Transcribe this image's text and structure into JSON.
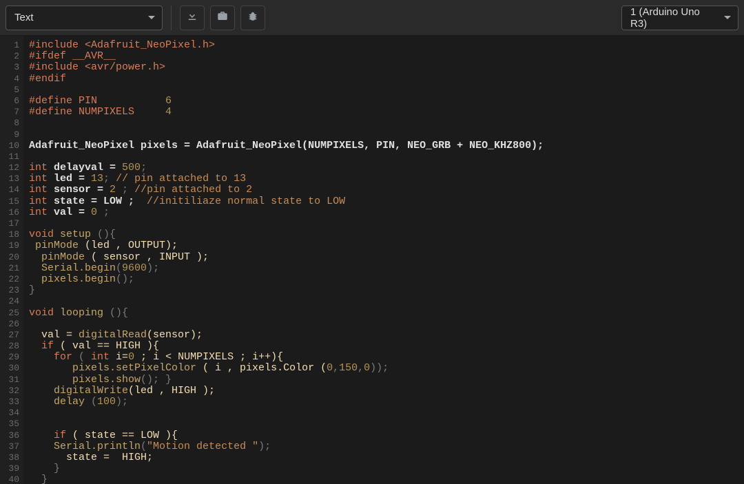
{
  "toolbar": {
    "mode_dropdown": "Text",
    "board_dropdown": "1 (Arduino Uno R3)"
  },
  "icons": {
    "download": "download-icon",
    "library": "briefcase-icon",
    "debug": "bug-icon"
  },
  "code_lines": [
    {
      "n": 1,
      "t": "#include <Adafruit_NeoPixel.h>",
      "cls": "cpp"
    },
    {
      "n": 2,
      "t": "#ifdef __AVR__",
      "cls": "cpp"
    },
    {
      "n": 3,
      "t": "#include <avr/power.h>",
      "cls": "cpp"
    },
    {
      "n": 4,
      "t": "#endif",
      "cls": "cpp"
    },
    {
      "n": 5,
      "t": "",
      "cls": "cg"
    },
    {
      "n": 6,
      "segments": [
        {
          "t": "#define PIN           ",
          "c": "cpp"
        },
        {
          "t": "6",
          "c": "cnu"
        }
      ]
    },
    {
      "n": 7,
      "segments": [
        {
          "t": "#define NUMPIXELS     ",
          "c": "cpp"
        },
        {
          "t": "4",
          "c": "cnu"
        }
      ]
    },
    {
      "n": 8,
      "t": "",
      "cls": "cg"
    },
    {
      "n": 9,
      "t": "",
      "cls": "cg"
    },
    {
      "n": 10,
      "segments": [
        {
          "t": "Adafruit_NeoPixel pixels = Adafruit_NeoPixel(NUMPIXELS, PIN, NEO_GRB + NEO_KHZ800);",
          "c": "cw"
        }
      ]
    },
    {
      "n": 11,
      "t": "",
      "cls": "cg"
    },
    {
      "n": 12,
      "segments": [
        {
          "t": "int ",
          "c": "cty"
        },
        {
          "t": "delayval = ",
          "c": "cw"
        },
        {
          "t": "500",
          "c": "cnu"
        },
        {
          "t": ";",
          "c": "cg"
        }
      ]
    },
    {
      "n": 13,
      "segments": [
        {
          "t": "int ",
          "c": "cty"
        },
        {
          "t": "led = ",
          "c": "cw"
        },
        {
          "t": "13",
          "c": "cnu"
        },
        {
          "t": "; ",
          "c": "cg"
        },
        {
          "t": "// pin attached to 13",
          "c": "ccm"
        }
      ]
    },
    {
      "n": 14,
      "segments": [
        {
          "t": "int ",
          "c": "cty"
        },
        {
          "t": "sensor = ",
          "c": "cw"
        },
        {
          "t": "2 ",
          "c": "cnu"
        },
        {
          "t": "; ",
          "c": "cg"
        },
        {
          "t": "//pin attached to 2",
          "c": "ccm"
        }
      ]
    },
    {
      "n": 15,
      "segments": [
        {
          "t": "int ",
          "c": "cty"
        },
        {
          "t": "state = LOW ;  ",
          "c": "cw"
        },
        {
          "t": "//initiliaze normal state to LOW",
          "c": "ccm"
        }
      ]
    },
    {
      "n": 16,
      "segments": [
        {
          "t": "int ",
          "c": "cty"
        },
        {
          "t": "val = ",
          "c": "cw"
        },
        {
          "t": "0 ",
          "c": "cnu"
        },
        {
          "t": ";",
          "c": "cg"
        }
      ]
    },
    {
      "n": 17,
      "t": "",
      "cls": "cg"
    },
    {
      "n": 18,
      "segments": [
        {
          "t": "void ",
          "c": "cty"
        },
        {
          "t": "setup ",
          "c": "cfn"
        },
        {
          "t": "(){",
          "c": "cg"
        }
      ]
    },
    {
      "n": 19,
      "segments": [
        {
          "t": " pinMode ",
          "c": "cfn"
        },
        {
          "t": "(led , OUTPUT);",
          "c": "cid"
        }
      ]
    },
    {
      "n": 20,
      "segments": [
        {
          "t": "  pinMode ",
          "c": "cfn"
        },
        {
          "t": "( sensor , INPUT );",
          "c": "cid"
        }
      ]
    },
    {
      "n": 21,
      "segments": [
        {
          "t": "  Serial.begin",
          "c": "cfn"
        },
        {
          "t": "(",
          "c": "cg"
        },
        {
          "t": "9600",
          "c": "cnu"
        },
        {
          "t": ");",
          "c": "cg"
        }
      ]
    },
    {
      "n": 22,
      "segments": [
        {
          "t": "  pixels.begin",
          "c": "cfn"
        },
        {
          "t": "();",
          "c": "cg"
        }
      ]
    },
    {
      "n": 23,
      "t": "}",
      "cls": "cg"
    },
    {
      "n": 24,
      "t": "",
      "cls": "cg"
    },
    {
      "n": 25,
      "segments": [
        {
          "t": "void ",
          "c": "cty"
        },
        {
          "t": "looping ",
          "c": "cfn"
        },
        {
          "t": "(){",
          "c": "cg"
        }
      ]
    },
    {
      "n": 26,
      "t": "",
      "cls": "cg"
    },
    {
      "n": 27,
      "segments": [
        {
          "t": "  val = ",
          "c": "cid"
        },
        {
          "t": "digitalRead",
          "c": "cfn"
        },
        {
          "t": "(sensor);",
          "c": "cid"
        }
      ]
    },
    {
      "n": 28,
      "segments": [
        {
          "t": "  if ",
          "c": "cty"
        },
        {
          "t": "( val == HIGH ){",
          "c": "cid"
        }
      ]
    },
    {
      "n": 29,
      "segments": [
        {
          "t": "    for ",
          "c": "cty"
        },
        {
          "t": "( ",
          "c": "cg"
        },
        {
          "t": "int ",
          "c": "cty"
        },
        {
          "t": "i=",
          "c": "cid"
        },
        {
          "t": "0 ",
          "c": "cnu"
        },
        {
          "t": "; i < NUMPIXELS ; i++){",
          "c": "cid"
        }
      ]
    },
    {
      "n": 30,
      "segments": [
        {
          "t": "       pixels.setPixelColor ",
          "c": "cfn"
        },
        {
          "t": "( i , pixels.Color (",
          "c": "cid"
        },
        {
          "t": "0",
          "c": "cnu"
        },
        {
          "t": ",",
          "c": "cg"
        },
        {
          "t": "150",
          "c": "cnu"
        },
        {
          "t": ",",
          "c": "cg"
        },
        {
          "t": "0",
          "c": "cnu"
        },
        {
          "t": "));",
          "c": "cg"
        }
      ]
    },
    {
      "n": 31,
      "segments": [
        {
          "t": "       pixels.show",
          "c": "cfn"
        },
        {
          "t": "(); }",
          "c": "cg"
        }
      ]
    },
    {
      "n": 32,
      "segments": [
        {
          "t": "    digitalWrite",
          "c": "cfn"
        },
        {
          "t": "(led , HIGH );",
          "c": "cid"
        }
      ]
    },
    {
      "n": 33,
      "segments": [
        {
          "t": "    delay ",
          "c": "cfn"
        },
        {
          "t": "(",
          "c": "cg"
        },
        {
          "t": "100",
          "c": "cnu"
        },
        {
          "t": ");",
          "c": "cg"
        }
      ]
    },
    {
      "n": 34,
      "t": "",
      "cls": "cg"
    },
    {
      "n": 35,
      "t": "",
      "cls": "cg"
    },
    {
      "n": 36,
      "segments": [
        {
          "t": "    if ",
          "c": "cty"
        },
        {
          "t": "( state == LOW ){",
          "c": "cid"
        }
      ]
    },
    {
      "n": 37,
      "segments": [
        {
          "t": "    Serial.println",
          "c": "cfn"
        },
        {
          "t": "(",
          "c": "cg"
        },
        {
          "t": "\"Motion detected \"",
          "c": "cst"
        },
        {
          "t": ");",
          "c": "cg"
        }
      ]
    },
    {
      "n": 38,
      "segments": [
        {
          "t": "      state =  HIGH;",
          "c": "cid"
        }
      ]
    },
    {
      "n": 39,
      "t": "    }",
      "cls": "cg"
    },
    {
      "n": 40,
      "t": "  }",
      "cls": "cg"
    }
  ]
}
